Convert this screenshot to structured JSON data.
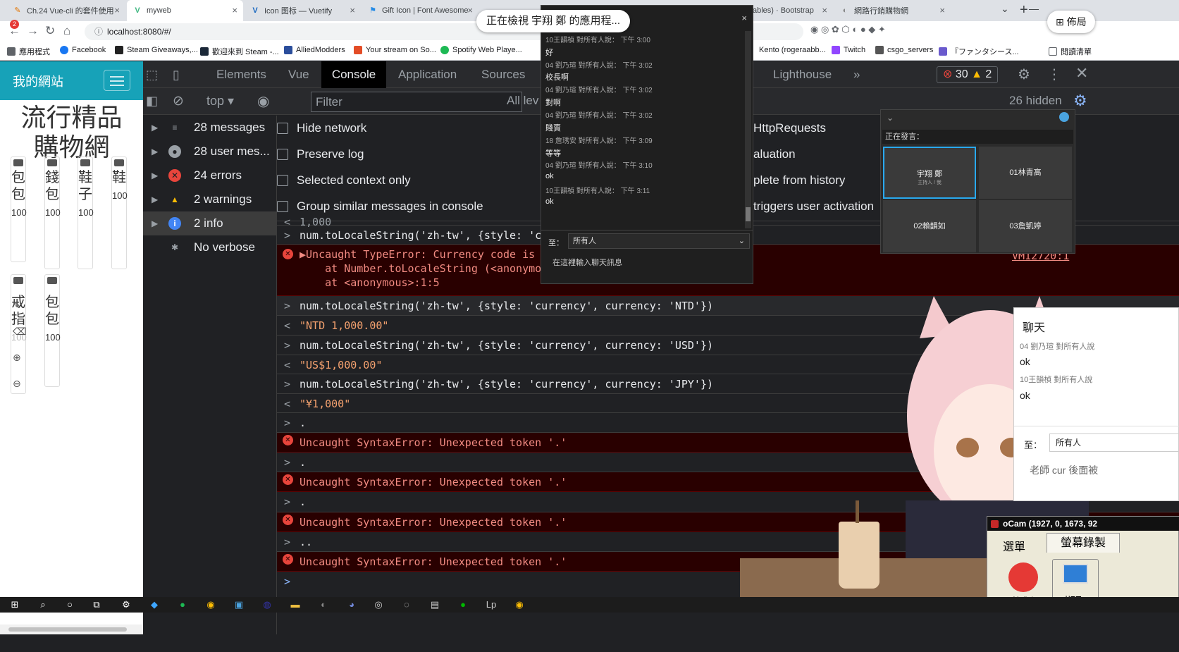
{
  "browser": {
    "tabs": [
      {
        "title": "Ch.24 Vue-cli 的套件使用",
        "fav": "✎",
        "color": "#e37400"
      },
      {
        "title": "myweb",
        "fav": "V",
        "color": "#41b883"
      },
      {
        "title": "Icon 图标 — Vuetify",
        "fav": "V",
        "color": "#1867c0"
      },
      {
        "title": "Gift Icon | Font Awesome",
        "fav": "⚑",
        "color": "#228ae6"
      },
      {
        "title": "ables) · Bootstrap",
        "fav": "B",
        "color": "#7952b3"
      },
      {
        "title": "網路行銷購物網",
        "fav": "◐",
        "color": "#888888"
      }
    ],
    "url": "localhost:8080/#/",
    "bookmarks": [
      "應用程式",
      "Facebook",
      "Steam Giveaways,...",
      "歡迎來到 Steam -...",
      "AlliedModders",
      "Your stream on So...",
      "Spotify Web Playe...",
      "Kento (rogeraabb...",
      "Twitch",
      "csgo_servers",
      "『ファンタシース...",
      "閱讀清單"
    ],
    "new_tab": "+"
  },
  "page": {
    "brand": "我的網站",
    "title": "流行精品購物網",
    "products": [
      {
        "name": "包包",
        "price": "100"
      },
      {
        "name": "錢包",
        "price": "100"
      },
      {
        "name": "鞋子",
        "price": "100"
      },
      {
        "name": "鞋",
        "price": "100"
      },
      {
        "name": "戒指",
        "price": "100"
      },
      {
        "name": "包包",
        "price": "100"
      }
    ]
  },
  "devtools": {
    "tabs": [
      "Elements",
      "Vue",
      "Console",
      "Application",
      "Sources",
      "Lighthouse",
      "»"
    ],
    "active_tab": "Console",
    "errors_badge": "30",
    "warnings_badge": "2",
    "context": "top",
    "filter_placeholder": "Filter",
    "levels": "All lev",
    "hidden": "26 hidden",
    "sidebar": [
      {
        "label": "28 messages",
        "icon": "≡"
      },
      {
        "label": "28 user mes...",
        "icon": "●"
      },
      {
        "label": "24 errors",
        "icon": "✕"
      },
      {
        "label": "2 warnings",
        "icon": "!"
      },
      {
        "label": "2 info",
        "icon": "i"
      },
      {
        "label": "No verbose",
        "icon": "✱"
      }
    ],
    "settings_left": [
      "Hide network",
      "Preserve log",
      "Selected context only",
      "Group similar messages in console"
    ],
    "settings_right": [
      "HttpRequests",
      "aluation",
      "plete from history",
      "triggers user activation"
    ],
    "console_lines": [
      {
        "kind": "out",
        "prefix": "<",
        "text": "1,000"
      },
      {
        "kind": "in",
        "prefix": ">",
        "text": "num.toLocaleString('zh-tw', {style: 'cu"
      },
      {
        "kind": "err",
        "prefix": "",
        "text": "▶Uncaught TypeError: Currency code is"
      },
      {
        "kind": "errcont",
        "prefix": "",
        "text": "    at Number.toLocaleString (<anonymou"
      },
      {
        "kind": "errcont",
        "prefix": "",
        "text": "    at <anonymous>:1:5"
      },
      {
        "kind": "in",
        "prefix": ">",
        "text": "num.toLocaleString('zh-tw', {style: 'currency', currency: 'NTD'})"
      },
      {
        "kind": "out",
        "prefix": "<",
        "text": "\"NTD 1,000.00\""
      },
      {
        "kind": "in",
        "prefix": ">",
        "text": "num.toLocaleString('zh-tw', {style: 'currency', currency: 'USD'})"
      },
      {
        "kind": "out",
        "prefix": "<",
        "text": "\"US$1,000.00\""
      },
      {
        "kind": "in",
        "prefix": ">",
        "text": "num.toLocaleString('zh-tw', {style: 'currency', currency: 'JPY'})"
      },
      {
        "kind": "out",
        "prefix": "<",
        "text": "\"¥1,000\""
      },
      {
        "kind": "in",
        "prefix": ">",
        "text": "."
      },
      {
        "kind": "err",
        "prefix": "",
        "text": "Uncaught SyntaxError: Unexpected token '.'"
      },
      {
        "kind": "in",
        "prefix": ">",
        "text": "."
      },
      {
        "kind": "err",
        "prefix": "",
        "text": "Uncaught SyntaxError: Unexpected token '.'"
      },
      {
        "kind": "in",
        "prefix": ">",
        "text": "."
      },
      {
        "kind": "err",
        "prefix": "",
        "text": "Uncaught SyntaxError: Unexpected token '.'"
      },
      {
        "kind": "in",
        "prefix": ">",
        "text": ".."
      },
      {
        "kind": "err",
        "prefix": "",
        "text": "Uncaught SyntaxError: Unexpected token '.'"
      },
      {
        "kind": "in",
        "prefix": ">",
        "text": ""
      }
    ],
    "vm_link": "VM12720:1"
  },
  "overlay": {
    "viewing": "正在檢視 宇翔 鄭 的應用程...",
    "layout_button": "佈局",
    "chat": [
      {
        "meta": "10王韻楨 對所有人說：  下午 3:00",
        "text": "好"
      },
      {
        "meta": "04 劉乃瑄 對所有人說：  下午 3:02",
        "text": "校長啊"
      },
      {
        "meta": "04 劉乃瑄 對所有人說：  下午 3:02",
        "text": "對啊"
      },
      {
        "meta": "04 劉乃瑄 對所有人說：  下午 3:02",
        "text": "賤賣"
      },
      {
        "meta": "18 詹琇安 對所有人說：  下午 3:09",
        "text": "等等"
      },
      {
        "meta": "04 劉乃瑄 對所有人說：  下午 3:10",
        "text": "ok"
      },
      {
        "meta": "10王韻楨 對所有人說：  下午 3:11",
        "text": "ok"
      }
    ],
    "chat_to_label": "至：",
    "chat_to_value": "所有人",
    "chat_input_placeholder": "在這裡輸入聊天訊息",
    "speaking_label": "正在發言：",
    "tiles": [
      {
        "name": "宇翔 鄭",
        "sub": "主持人 / 我"
      },
      {
        "name": "01林青高",
        "sub": ""
      },
      {
        "name": "02賴韻如",
        "sub": ""
      },
      {
        "name": "03詹凱婷",
        "sub": ""
      }
    ],
    "chat2_title": "聊天",
    "chat2": [
      {
        "meta": "04 劉乃瑄 對所有人說",
        "text": "ok"
      },
      {
        "meta": "10王韻楨 對所有人說",
        "text": "ok"
      }
    ],
    "chat2_to_label": "至：",
    "chat2_to_value": "所有人",
    "chat2_draft": "老師 cur 後面被",
    "ocam_title": "oCam (1927, 0, 1673, 92",
    "ocam_menu": "選單",
    "ocam_tab": "螢幕錄製",
    "ocam_record": "錄製",
    "ocam_capture": "擷取"
  },
  "colors": {
    "page_header": "#17a2b8",
    "error_red": "#e8453c",
    "console_bg": "#202124"
  }
}
